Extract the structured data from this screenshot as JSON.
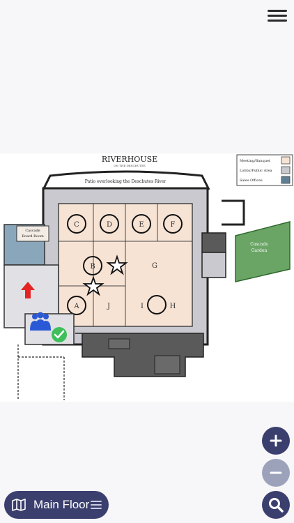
{
  "header": {
    "menu_icon": "hamburger-menu-icon"
  },
  "map": {
    "brand_title": "RIVERHOUSE",
    "brand_subtitle": "ON THE DESCHUTES",
    "patio_label": "Patio overlooking the Deschutes River",
    "rooms": {
      "cascade_board_room_line1": "Cascade",
      "cascade_board_room_line2": "Board Room",
      "cascade_garden_line1": "Cascade",
      "cascade_garden_line2": "Garden",
      "A": "A",
      "B": "B",
      "C": "C",
      "D": "D",
      "E": "E",
      "F": "F",
      "G": "G",
      "H": "H",
      "I": "I",
      "J": "J"
    },
    "legend": [
      {
        "label": "Meeting/Banquet",
        "color": "#f7e3d4"
      },
      {
        "label": "Lobby/Public Area",
        "color": "#c9c9cf"
      },
      {
        "label": "Sales Offices",
        "color": "#5f7f96"
      }
    ],
    "markers": {
      "favorite_icon": "star-outline-icon",
      "entrance_icon": "red-arrow-up-icon",
      "group_icon": "people-group-icon",
      "checkin_icon": "green-check-icon"
    },
    "colors": {
      "meeting": "#f7e3d4",
      "lobby": "#c9c9cf",
      "sales": "#6e8ea6",
      "garden": "#6aa566",
      "service": "#5a5a5a"
    }
  },
  "controls": {
    "zoom_in_icon": "plus-icon",
    "zoom_out_icon": "minus-icon",
    "search_icon": "magnifier-icon"
  },
  "floor_selector": {
    "label": "Main Floor",
    "map_icon": "folded-map-icon",
    "list_icon": "list-icon"
  }
}
